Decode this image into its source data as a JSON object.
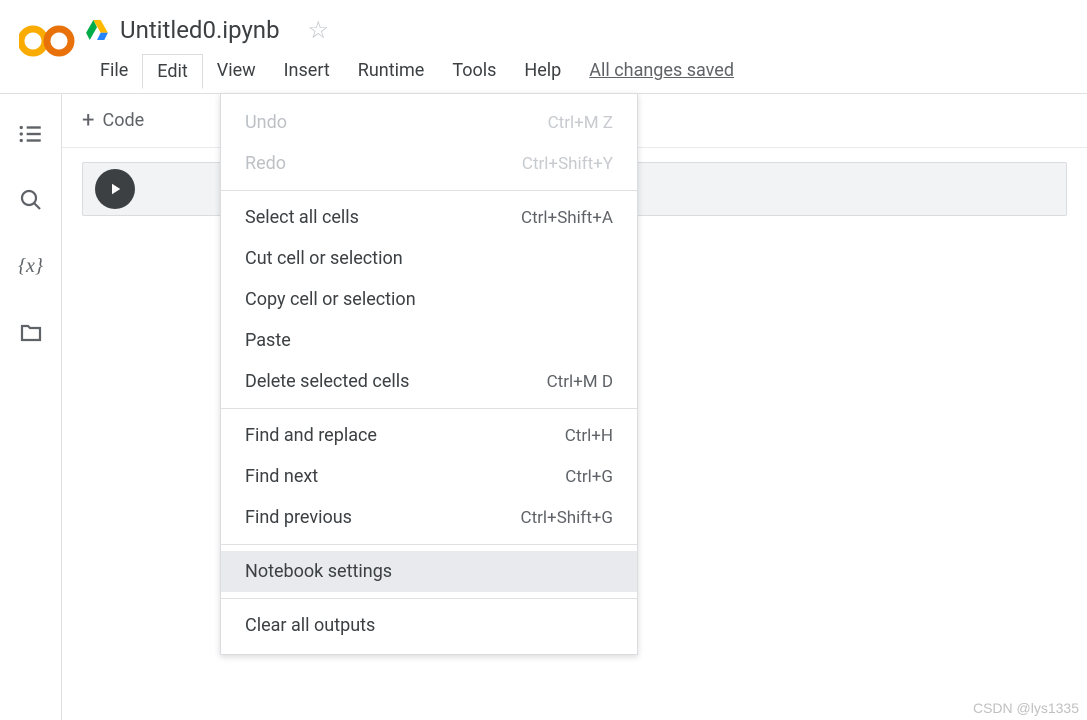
{
  "doc": {
    "title": "Untitled0.ipynb"
  },
  "menubar": {
    "items": [
      "File",
      "Edit",
      "View",
      "Insert",
      "Runtime",
      "Tools",
      "Help"
    ],
    "save_status": "All changes saved"
  },
  "toolbar": {
    "add_code_label": "Code"
  },
  "edit_menu": {
    "groups": [
      [
        {
          "label": "Undo",
          "shortcut": "Ctrl+M Z",
          "disabled": true
        },
        {
          "label": "Redo",
          "shortcut": "Ctrl+Shift+Y",
          "disabled": true
        }
      ],
      [
        {
          "label": "Select all cells",
          "shortcut": "Ctrl+Shift+A"
        },
        {
          "label": "Cut cell or selection",
          "shortcut": ""
        },
        {
          "label": "Copy cell or selection",
          "shortcut": ""
        },
        {
          "label": "Paste",
          "shortcut": ""
        },
        {
          "label": "Delete selected cells",
          "shortcut": "Ctrl+M D"
        }
      ],
      [
        {
          "label": "Find and replace",
          "shortcut": "Ctrl+H"
        },
        {
          "label": "Find next",
          "shortcut": "Ctrl+G"
        },
        {
          "label": "Find previous",
          "shortcut": "Ctrl+Shift+G"
        }
      ],
      [
        {
          "label": "Notebook settings",
          "shortcut": "",
          "hovered": true
        }
      ],
      [
        {
          "label": "Clear all outputs",
          "shortcut": ""
        }
      ]
    ]
  },
  "watermark": "CSDN @lys1335"
}
